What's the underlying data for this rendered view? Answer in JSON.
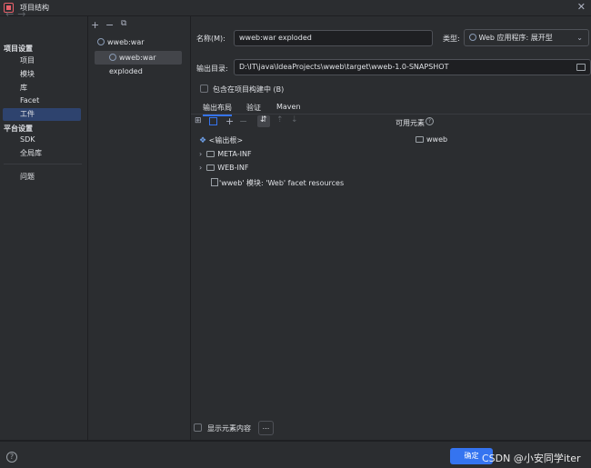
{
  "window": {
    "title": "项目结构"
  },
  "nav": {
    "section_project": "项目设置",
    "items_project": [
      "项目",
      "模块",
      "库",
      "Facet",
      "工件"
    ],
    "section_platform": "平台设置",
    "items_platform": [
      "SDK",
      "全局库"
    ],
    "problems": "问题",
    "selected": "工件"
  },
  "artifacts": {
    "toolbar": [
      "+",
      "−",
      "⧉"
    ],
    "items": [
      "wweb:war",
      "wweb:war exploded"
    ],
    "selected": "wweb:war exploded"
  },
  "form": {
    "name_label": "名称(M):",
    "name_value": "wweb:war exploded",
    "type_label": "类型:",
    "type_value": "Web 应用程序: 展开型",
    "output_label": "输出目录:",
    "output_value": "D:\\IT\\java\\IdeaProjects\\wweb\\target\\wweb-1.0-SNAPSHOT",
    "include_build": "包含在项目构建中 (B)"
  },
  "tabs": [
    "输出布局",
    "验证",
    "Maven"
  ],
  "layout": {
    "available_label": "可用元素",
    "output_root": "<输出根>",
    "tree": [
      "META-INF",
      "WEB-INF",
      "'wweb' 模块: 'Web' facet resources"
    ],
    "available": [
      "wweb"
    ]
  },
  "footer": {
    "show_content": "显示元素内容",
    "more": "...",
    "help": "?",
    "ok": "确定",
    "watermark": "CSDN @小安同学iter"
  }
}
